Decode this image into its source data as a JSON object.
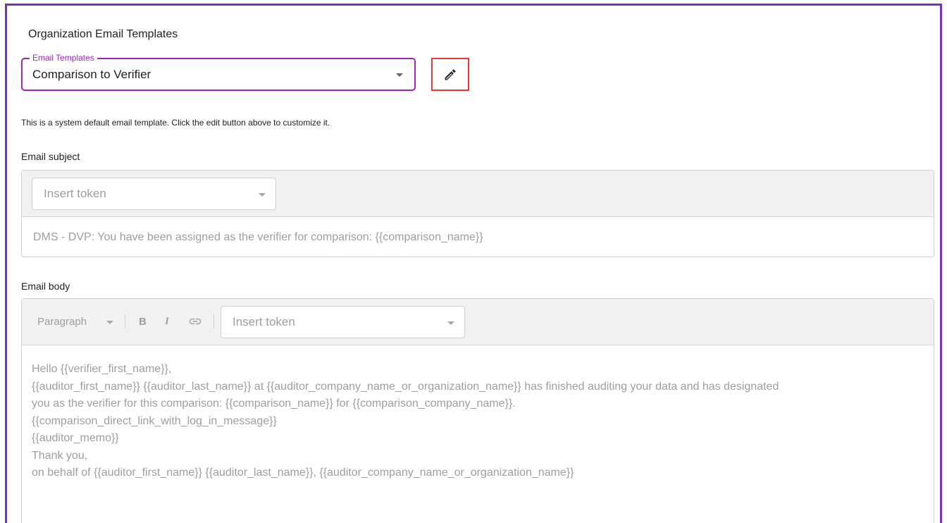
{
  "page": {
    "title": "Organization Email Templates",
    "info": "This is a system default email template. Click the edit button above to customize it."
  },
  "template_select": {
    "legend": "Email Templates",
    "value": "Comparison to Verifier"
  },
  "edit_button": {
    "icon": "pencil-icon"
  },
  "subject": {
    "label": "Email subject",
    "token_placeholder": "Insert token",
    "content": "DMS - DVP: You have been assigned as the verifier for comparison: {{comparison_name}}"
  },
  "body": {
    "label": "Email body",
    "toolbar": {
      "paragraph": "Paragraph",
      "bold": "B",
      "italic": "I",
      "token_placeholder": "Insert token"
    },
    "lines": [
      "Hello {{verifier_first_name}},",
      "{{auditor_first_name}} {{auditor_last_name}} at {{auditor_company_name_or_organization_name}} has finished auditing your data and has designated",
      "you as the verifier for this comparison: {{comparison_name}} for {{comparison_company_name}}.",
      "{{comparison_direct_link_with_log_in_message}}",
      "{{auditor_memo}}",
      "Thank you,",
      "on behalf of {{auditor_first_name}} {{auditor_last_name}}, {{auditor_company_name_or_organization_name}}"
    ]
  },
  "colors": {
    "frame": "#7b2fbf",
    "focus": "#9c27b0",
    "highlight": "#e53935",
    "muted_text": "#9e9e9e"
  }
}
